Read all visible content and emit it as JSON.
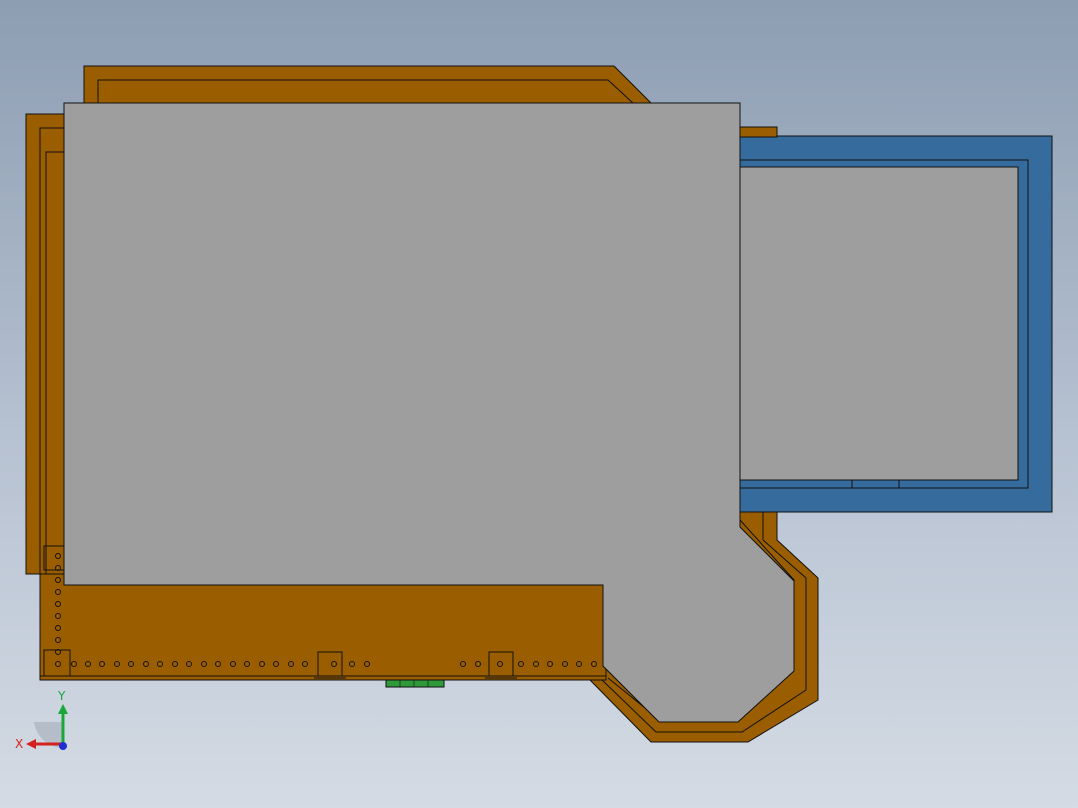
{
  "app": {
    "view": "Top"
  },
  "colors": {
    "background_top": "#8d9db2",
    "background_bottom": "#d4dbe4",
    "bronze_part": "#9a5e00",
    "gray_plate": "#9e9e9e",
    "blue_frame": "#356b9d",
    "green_connector": "#2e9a3a",
    "edge_line": "#111111"
  },
  "triad": {
    "x_label": "X",
    "y_label": "Y",
    "x_color": "#d42020",
    "y_color": "#18a83a",
    "z_color": "#2030d0"
  }
}
